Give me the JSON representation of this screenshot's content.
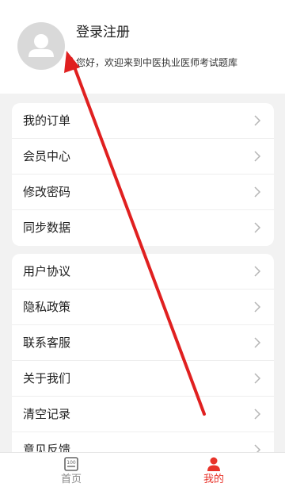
{
  "profile": {
    "login_label": "登录注册",
    "welcome_text": "您好，欢迎来到中医执业医师考试题库"
  },
  "menu_group_1": [
    {
      "label": "我的订单"
    },
    {
      "label": "会员中心"
    },
    {
      "label": "修改密码"
    },
    {
      "label": "同步数据"
    }
  ],
  "menu_group_2": [
    {
      "label": "用户协议"
    },
    {
      "label": "隐私政策"
    },
    {
      "label": "联系客服"
    },
    {
      "label": "关于我们"
    },
    {
      "label": "清空记录"
    },
    {
      "label": "意见反馈"
    }
  ],
  "tabbar": {
    "home_label": "首页",
    "home_icon": "quiz-book-icon",
    "mine_label": "我的",
    "mine_icon": "user-icon"
  },
  "colors": {
    "accent": "#e8332a",
    "annotation_arrow": "#e02020",
    "background": "#f2f2f2"
  }
}
